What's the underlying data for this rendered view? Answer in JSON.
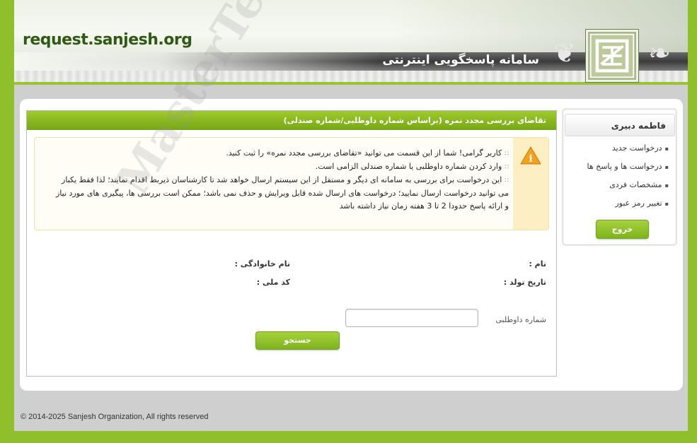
{
  "header": {
    "site_name": "request.sanjesh.org",
    "system_title": "سامانه پاسخگویی اینترنتی"
  },
  "sidebar": {
    "user_name": "فاطمه دبیری",
    "items": [
      {
        "label": "درخواست جدید"
      },
      {
        "label": "درخواست ها و پاسخ ها"
      },
      {
        "label": "مشخصات فردی"
      },
      {
        "label": "تغییر رمز عبور"
      }
    ],
    "logout_label": "خروج"
  },
  "panel": {
    "title": "تقاضای بررسی مجدد نمره (براساس شماره داوطلبی/شماره صندلی)",
    "notice": [
      "کاربر گرامی! شما از این قسمت می توانید «تقاضای بررسی مجدد نمره» را ثبت کنید.",
      "وارد کردن شماره داوطلبی یا شماره صندلی الزامی است.",
      "این درخواست برای بررسی به سامانه ای دیگر و مستقل از این سیستم ارسال خواهد شد تا کارشناسان ذیربط اقدام نمایند؛ لذا فقط یکبار می توانید درخواست ارسال نمایید؛ درخواست های ارسال شده قابل ویرایش و حذف نمی باشد؛ ممکن است بررسی ها، پیگیری های مورد نیاز و ارائه پاسخ حدودا 2 تا 3 هفته زمان نیاز داشته باشد"
    ],
    "fields": {
      "name_label": "نام :",
      "family_label": "نام خانوادگی :",
      "birth_label": "تاریخ تولد :",
      "national_code_label": "کد ملی :",
      "candidate_number_label": "شماره داوطلبی",
      "candidate_number_value": ""
    },
    "search_label": "جستجو"
  },
  "watermark": "MasterTest.ir",
  "footer": {
    "copyright": "© 2014-2025 Sanjesh Organization, All rights reserved"
  },
  "colors": {
    "accent_green": "#8fbf2a",
    "title_green": "#77a615",
    "notice_bg": "#fdefc4"
  }
}
